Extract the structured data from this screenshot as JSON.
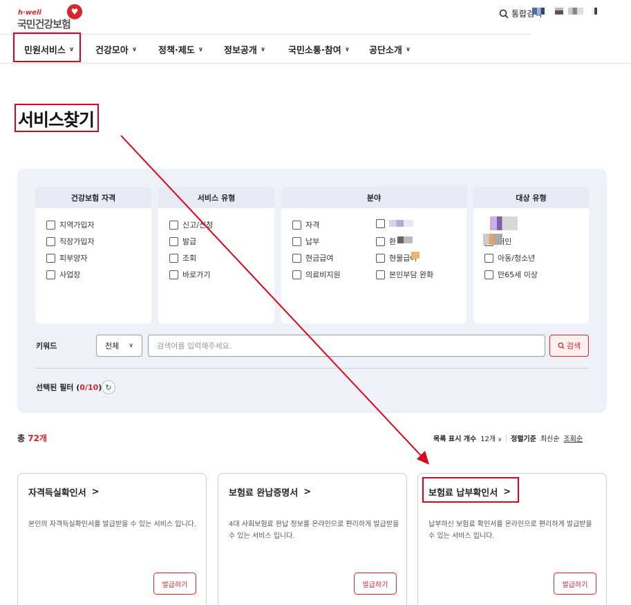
{
  "header": {
    "logo_small": "h·well",
    "logo_main": "국민건강보험",
    "logo_icon": "heart-icon",
    "search_label": "통합검색",
    "search_icon": "search-icon"
  },
  "nav": {
    "items": [
      {
        "label": "민원서비스"
      },
      {
        "label": "건강모아"
      },
      {
        "label": "정책·제도"
      },
      {
        "label": "정보공개"
      },
      {
        "label": "국민소통·참여"
      },
      {
        "label": "공단소개"
      }
    ]
  },
  "page_title": "서비스찾기",
  "filters": {
    "groups": [
      {
        "title": "건강보험 자격",
        "options": [
          "지역가입자",
          "직장가입자",
          "피부양자",
          "사업장"
        ]
      },
      {
        "title": "서비스 유형",
        "options": [
          "신고/신청",
          "발급",
          "조회",
          "바로가기"
        ]
      },
      {
        "title": "분야",
        "options_col1": [
          "자격",
          "납부",
          "현금급여",
          "의료비지원"
        ],
        "options_col2": [
          "",
          "환",
          "현물급여",
          "본인부담 완화"
        ]
      },
      {
        "title": "대상 유형",
        "options": [
          "",
          "애인",
          "아동/청소년",
          "만65세 이상"
        ]
      }
    ]
  },
  "keyword": {
    "label": "키워드",
    "select_value": "전체",
    "placeholder": "검색어를 입력해주세요.",
    "search_button": "검색"
  },
  "selected_filter": {
    "label": "선택된 필터 (",
    "count": "0/10",
    "close": ")"
  },
  "results": {
    "total_prefix": "총 ",
    "total_count": "72개",
    "list_count_label": "목록 표시 개수",
    "list_count_value": "12개",
    "sort_label": "정렬기준",
    "sort_latest": "최신순",
    "sort_views": "조회순"
  },
  "services": [
    {
      "title": "자격득실확인서",
      "desc": "본인의 자격득실확인서를 발급받을 수 있는 서비스 입니다.",
      "button": "발급하기"
    },
    {
      "title": "보험료 완납증명서",
      "desc": "4대 사회보험료 완납 정보를 온라인으로 편리하게 발급받을 수 있는 서비스 입니다.",
      "button": "발급하기"
    },
    {
      "title": "보험료 납부확인서",
      "desc": "납부하신 보험료 확인서를 온라인으로 편리하게 발급받을 수 있는 서비스 입니다.",
      "button": "발급하기"
    }
  ],
  "colors": {
    "accent_red": "#d9232d",
    "highlight_red": "#e1001a",
    "panel_bg": "#eef1f7",
    "card_header_bg": "#e7eaf5"
  }
}
